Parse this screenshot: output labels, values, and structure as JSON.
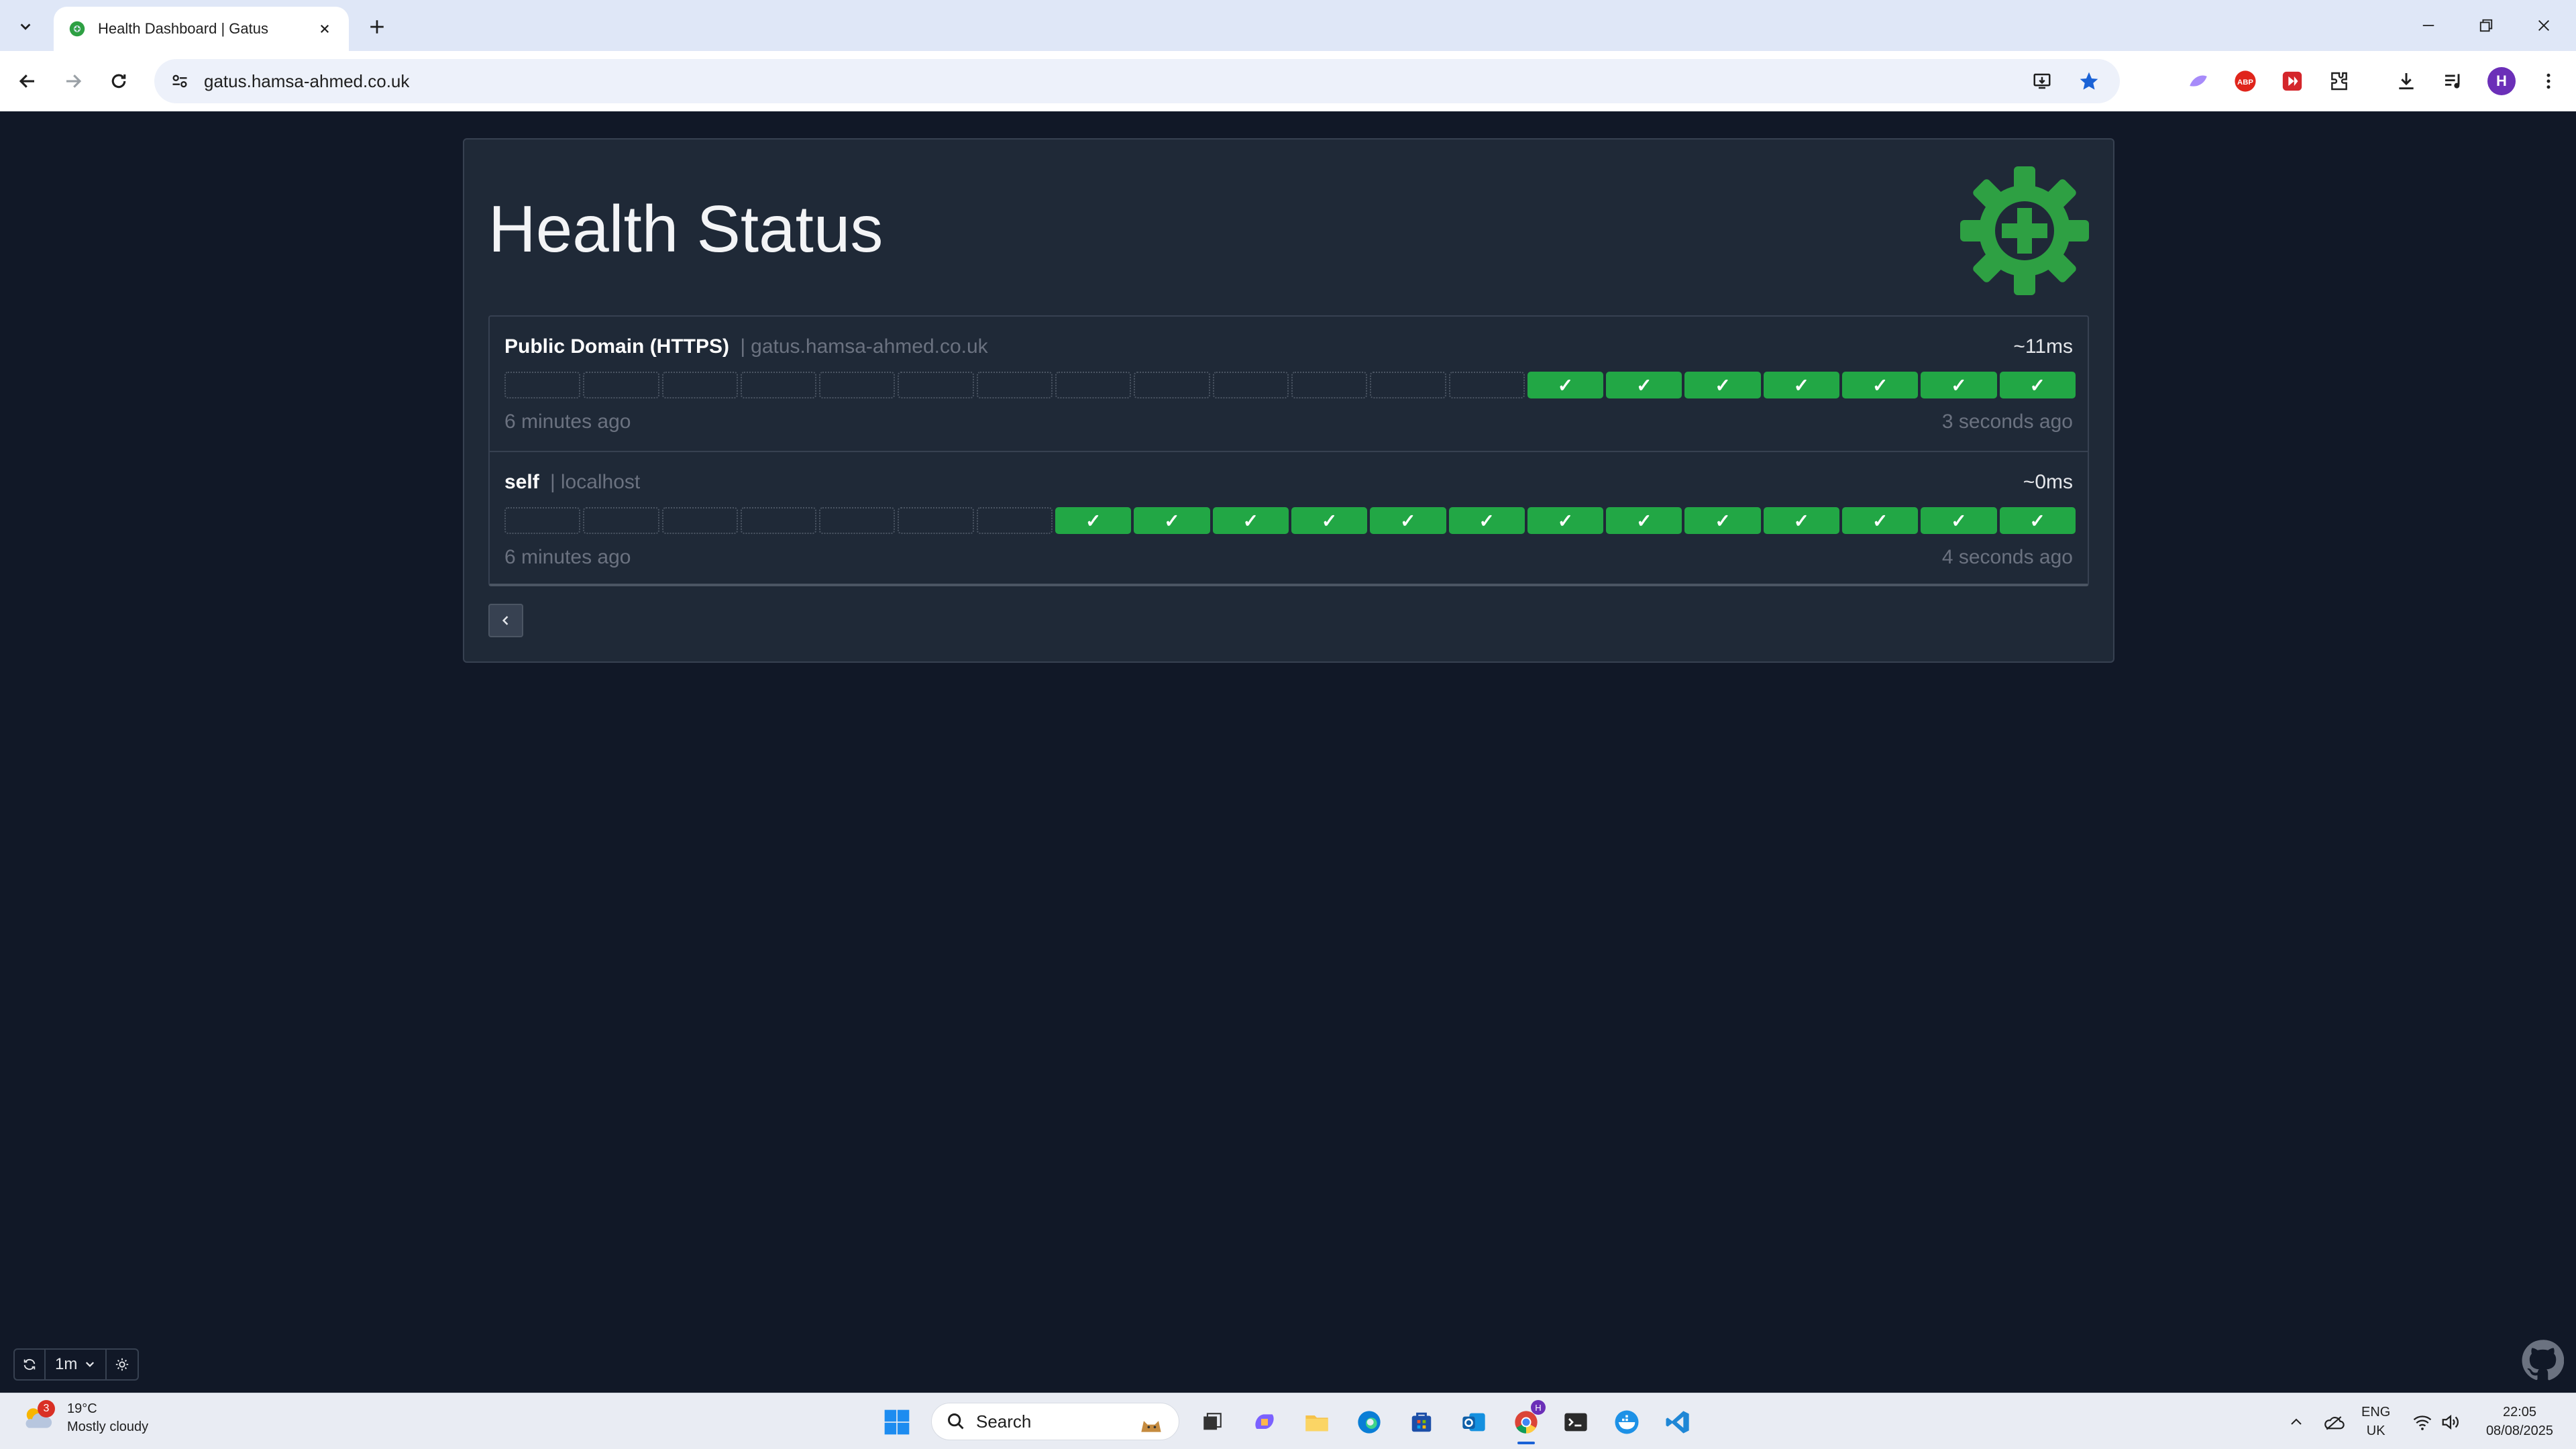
{
  "browser": {
    "tab_title": "Health Dashboard | Gatus",
    "url": "gatus.hamsa-ahmed.co.uk",
    "profile_initial": "H"
  },
  "dashboard": {
    "title": "Health Status",
    "endpoints": [
      {
        "name": "Public Domain (HTTPS)",
        "separator": "|",
        "hostname": "gatus.hamsa-ahmed.co.uk",
        "response_time": "~11ms",
        "oldest_label": "6 minutes ago",
        "newest_label": "3 seconds ago",
        "results": [
          null,
          null,
          null,
          null,
          null,
          null,
          null,
          null,
          null,
          null,
          null,
          null,
          null,
          "success",
          "success",
          "success",
          "success",
          "success",
          "success",
          "success"
        ]
      },
      {
        "name": "self",
        "separator": "|",
        "hostname": "localhost",
        "response_time": "~0ms",
        "oldest_label": "6 minutes ago",
        "newest_label": "4 seconds ago",
        "results": [
          null,
          null,
          null,
          null,
          null,
          null,
          null,
          "success",
          "success",
          "success",
          "success",
          "success",
          "success",
          "success",
          "success",
          "success",
          "success",
          "success",
          "success",
          "success"
        ]
      }
    ],
    "check_mark": "✓",
    "refresh_interval": "1m"
  },
  "taskbar": {
    "weather_temp": "19°C",
    "weather_desc": "Mostly cloudy",
    "weather_badge": "3",
    "search_label": "Search",
    "lang_line1": "ENG",
    "lang_line2": "UK",
    "time": "22:05",
    "date": "08/08/2025",
    "chrome_badge": "H"
  },
  "colors": {
    "page_bg": "#111827",
    "card_bg": "#1f2937",
    "success": "#22a745",
    "logo_green": "#2ea043"
  },
  "icons": [
    "tab-search-icon",
    "gatus-favicon-icon",
    "close-icon",
    "plus-icon",
    "minimize-icon",
    "restore-icon",
    "back-icon",
    "forward-icon",
    "reload-icon",
    "site-info-icon",
    "install-icon",
    "bookmark-star-icon",
    "extension-icon",
    "download-icon",
    "media-icon",
    "refresh-icon",
    "chevron-down-icon",
    "sun-icon",
    "github-icon",
    "windows-start-icon"
  ]
}
